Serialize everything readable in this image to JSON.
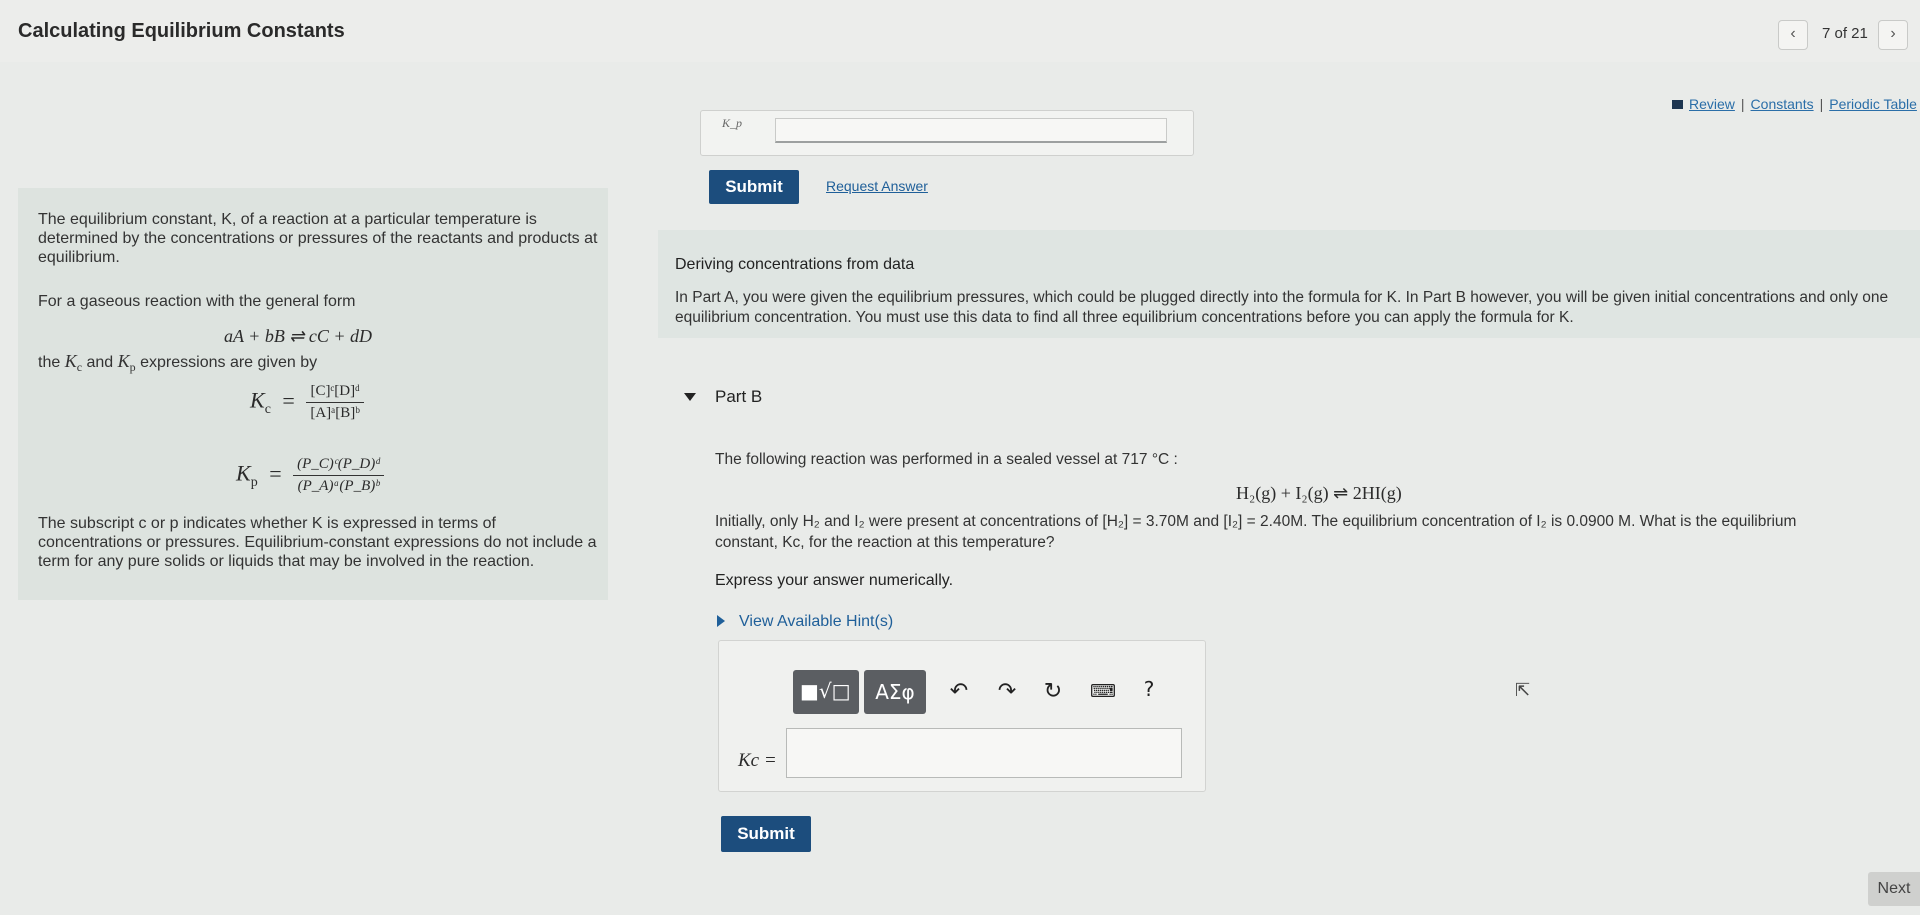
{
  "header": {
    "title": "Calculating Equilibrium Constants",
    "prev_icon": "chevron-left-icon",
    "page_count": "7 of 21",
    "next_icon": "chevron-right-icon"
  },
  "resources": {
    "review": "Review",
    "constants": "Constants",
    "periodic_table": "Periodic Table",
    "separator": "|"
  },
  "part_a": {
    "answer_label": "K_p",
    "submit": "Submit",
    "request_answer": "Request Answer"
  },
  "intro": {
    "p1": "The equilibrium constant, K, of a reaction at a particular temperature is determined by the concentrations or pressures of the reactants and products at equilibrium.",
    "p2": "For a gaseous reaction with the general form",
    "general_reaction": "aA + bB ⇌ cC + dD",
    "p3_pre": "the",
    "p3_and": "and",
    "p3_post": "expressions are given by",
    "kc_symbol": "K",
    "kc_sub": "c",
    "kc_num": "[C]ᶜ[D]ᵈ",
    "kc_den": "[A]ᵃ[B]ᵇ",
    "kp_symbol": "K",
    "kp_sub": "p",
    "kp_num": "(P_C)ᶜ(P_D)ᵈ",
    "kp_den": "(P_A)ᵃ(P_B)ᵇ",
    "p4": "The subscript c or p indicates whether K is expressed in terms of concentrations or pressures. Equilibrium-constant expressions do not include a term for any pure solids or liquids that may be involved in the reaction."
  },
  "deriving": {
    "title": "Deriving concentrations from data",
    "text": "In Part A, you were given the equilibrium pressures, which could be plugged directly into the formula for K. In Part B however, you will be given initial concentrations and only one equilibrium concentration. You must use this data to find all three equilibrium concentrations before you can apply the formula for K."
  },
  "part_b": {
    "title": "Part B",
    "intro": "The following reaction was performed in a sealed vessel at 717 °C :",
    "reaction": "H₂(g) + I₂(g) ⇌ 2HI(g)",
    "question_1": "Initially, only H₂ and I₂ were present at concentrations of [H₂] = 3.70M and [I₂] = 2.40M. The equilibrium concentration of I₂ is 0.0900 M. What is the equilibrium",
    "question_2": "constant, Kc, for the reaction at this temperature?",
    "instruction": "Express your answer numerically.",
    "hint": "View Available Hint(s)",
    "greek_button": "ΑΣφ",
    "help": "?",
    "answer_label": "Kc =",
    "answer_value": "",
    "submit": "Submit"
  },
  "footer": {
    "next": "Next"
  }
}
